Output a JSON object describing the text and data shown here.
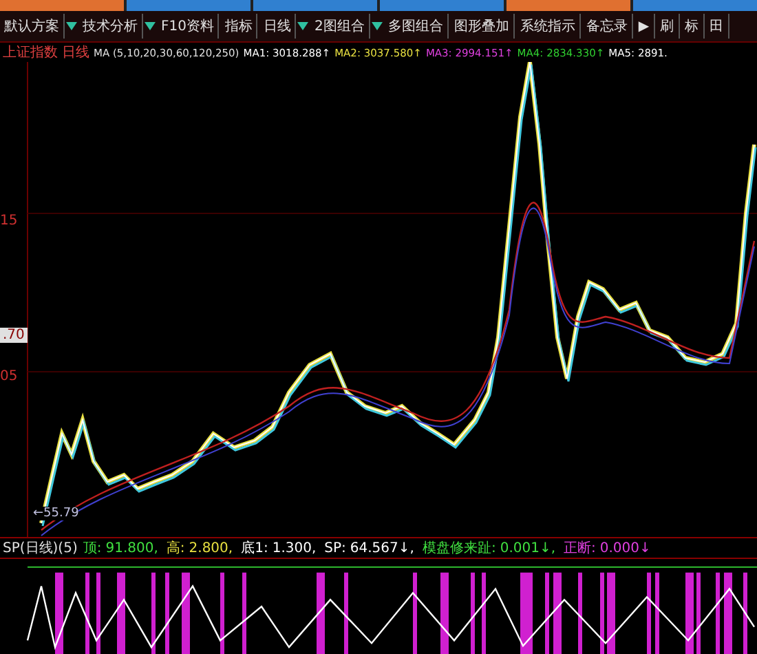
{
  "toolbar": [
    {
      "label": "默认方案",
      "dropdown": false
    },
    {
      "label": "技术分析",
      "dropdown": true
    },
    {
      "label": "F10资料",
      "dropdown": true
    },
    {
      "label": "指标",
      "dropdown": false
    },
    {
      "label": "日线",
      "dropdown": false
    },
    {
      "label": "2图组合",
      "dropdown": true
    },
    {
      "label": "多图组合",
      "dropdown": true
    },
    {
      "label": "图形叠加",
      "dropdown": false
    },
    {
      "label": "系统指示",
      "dropdown": false
    },
    {
      "label": "备忘录",
      "dropdown": false
    },
    {
      "label": "▶",
      "dropdown": false
    },
    {
      "label": "刷",
      "dropdown": false
    },
    {
      "label": "标",
      "dropdown": false
    },
    {
      "label": "田",
      "dropdown": false
    }
  ],
  "ma_line": {
    "index_name": "上证指数",
    "period": "日线",
    "params": "MA (5,10,20,30,60,120,250)",
    "values": [
      {
        "text": "MA1: 3018.288↑",
        "color": "#ffffff"
      },
      {
        "text": "MA2: 3037.580↑",
        "color": "#e8e040"
      },
      {
        "text": "MA3: 2994.151↑",
        "color": "#e040e0"
      },
      {
        "text": "MA4: 2834.330↑",
        "color": "#30d030"
      },
      {
        "text": "MA5: 2891.",
        "color": "#ffffff"
      }
    ]
  },
  "price_axis": [
    {
      "label": "15",
      "selected": false
    },
    {
      "label": ".70",
      "selected": true
    },
    {
      "label": "05",
      "selected": false
    }
  ],
  "low_marker": "←55.79",
  "indicator_line": {
    "name": "SP(日线)(5)",
    "values": [
      {
        "label": "顶:",
        "value": "91.800,",
        "color": "#40e040"
      },
      {
        "label": "高:",
        "value": "2.800,",
        "color": "#e8e040"
      },
      {
        "label": "底1:",
        "value": "1.300,",
        "color": "#ffffff"
      },
      {
        "label": "SP:",
        "value": "64.567↓,",
        "color": "#ffffff"
      },
      {
        "label": "模盘修来趾:",
        "value": "0.001↓,",
        "color": "#40e040"
      },
      {
        "label": "正断:",
        "value": "0.000↓",
        "color": "#e040e0"
      }
    ]
  }
}
